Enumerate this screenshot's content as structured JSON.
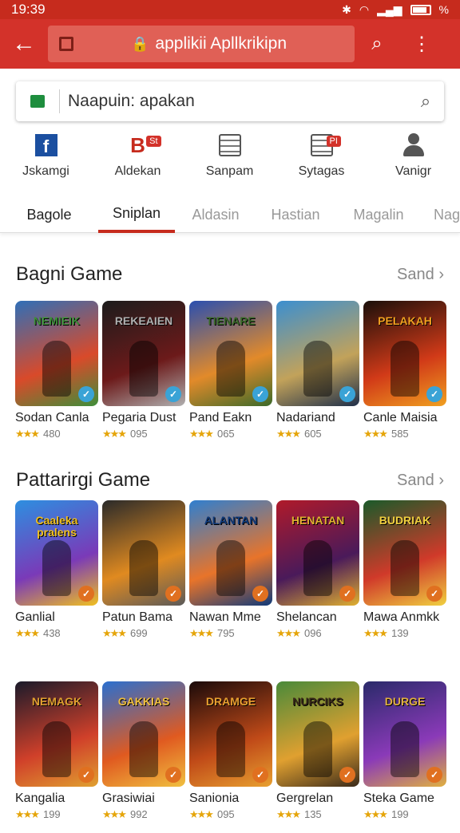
{
  "status_bar": {
    "time": "19:39",
    "battery": "%"
  },
  "app_bar": {
    "url_text": "applikii Apllkrikipn"
  },
  "search": {
    "value": "Naapuin: apakan"
  },
  "categories": [
    {
      "label": "Jskamgi",
      "icon": "facebook-icon"
    },
    {
      "label": "Aldekan",
      "icon": "b-icon",
      "badge": "St"
    },
    {
      "label": "Sanpam",
      "icon": "calendar-icon"
    },
    {
      "label": "Sytagas",
      "icon": "document-icon",
      "badge": "PI"
    },
    {
      "label": "Vanigr",
      "icon": "person-icon"
    }
  ],
  "tabs": [
    "Bagole",
    "Sniplan",
    "Aldasin",
    "Hastian",
    "Magalin",
    "Nag"
  ],
  "sections": [
    {
      "title": "Bagni Game",
      "more": "Sand",
      "games": [
        {
          "name": "Sodan Canla",
          "rating": "480",
          "art_title": "NEMIEIK"
        },
        {
          "name": "Pegaria Dust",
          "rating": "095",
          "art_title": "REKEAIEN"
        },
        {
          "name": "Pand Eakn",
          "rating": "065",
          "art_title": "TIENARE"
        },
        {
          "name": "Nadariand",
          "rating": "605",
          "art_title": ""
        },
        {
          "name": "Canle Maisia",
          "rating": "585",
          "art_title": "PELAKAH"
        }
      ]
    },
    {
      "title": "Pattarirgi Game",
      "more": "Sand",
      "games": [
        {
          "name": "Ganlial",
          "rating": "438",
          "art_title": "Caaleka pralens"
        },
        {
          "name": "Patun Bama",
          "rating": "699",
          "art_title": ""
        },
        {
          "name": "Nawan Mme",
          "rating": "795",
          "art_title": "ALANTAN"
        },
        {
          "name": "Shelancan",
          "rating": "096",
          "art_title": "HENATAN"
        },
        {
          "name": "Mawa Anmkk",
          "rating": "139",
          "art_title": "BUDRIAK"
        }
      ]
    },
    {
      "title": "",
      "more": "",
      "games": [
        {
          "name": "Kangalia",
          "rating": "199",
          "art_title": "NEMAGK"
        },
        {
          "name": "Grasiwiai",
          "rating": "992",
          "art_title": "GAKKIAS"
        },
        {
          "name": "Sanionia",
          "rating": "095",
          "art_title": "DRAMGE"
        },
        {
          "name": "Gergrelan",
          "rating": "135",
          "art_title": "NURCIKS"
        },
        {
          "name": "Steka Game",
          "rating": "199",
          "art_title": "DURGE"
        }
      ]
    }
  ],
  "colors": {
    "brand": "#d3322a",
    "accent_tab": "#c62b1d",
    "star": "#e5a50a"
  }
}
